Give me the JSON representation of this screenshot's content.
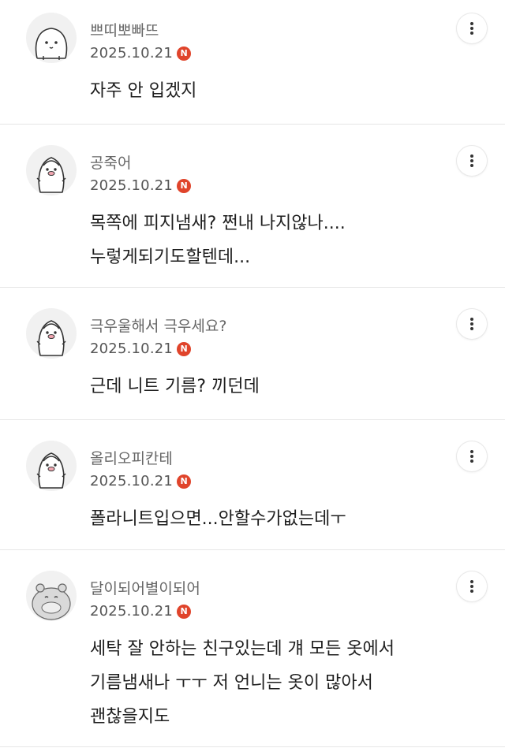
{
  "comments": [
    {
      "nickname": "쁘띠뽀빠뜨",
      "date": "2025.10.21",
      "badge": "N",
      "avatar": "blob-face-avatar",
      "body": "자주 안 입겠지"
    },
    {
      "nickname": "공죽어",
      "date": "2025.10.21",
      "badge": "N",
      "avatar": "penguin-avatar",
      "body": "목쪽에 피지냄새? 쩐내 나지않나....\n누렇게되기도할텐데..."
    },
    {
      "nickname": "극우울해서 극우세요?",
      "date": "2025.10.21",
      "badge": "N",
      "avatar": "penguin-avatar",
      "body": "근데 니트 기름? 끼던데"
    },
    {
      "nickname": "올리오피칸테",
      "date": "2025.10.21",
      "badge": "N",
      "avatar": "penguin-avatar",
      "body": "폴라니트입으면...안할수가없는데ㅜ"
    },
    {
      "nickname": "달이되어별이되어",
      "date": "2025.10.21",
      "badge": "N",
      "avatar": "hippo-avatar",
      "body": "세탁 잘 안하는 친구있는데 걔 모든 옷에서\n기름냄새나 ㅜㅜ 저 언니는 옷이 많아서\n괜찮을지도"
    }
  ],
  "colors": {
    "badge": "#e0442b",
    "divider": "#e6e6e6",
    "meta_text": "#555555"
  }
}
